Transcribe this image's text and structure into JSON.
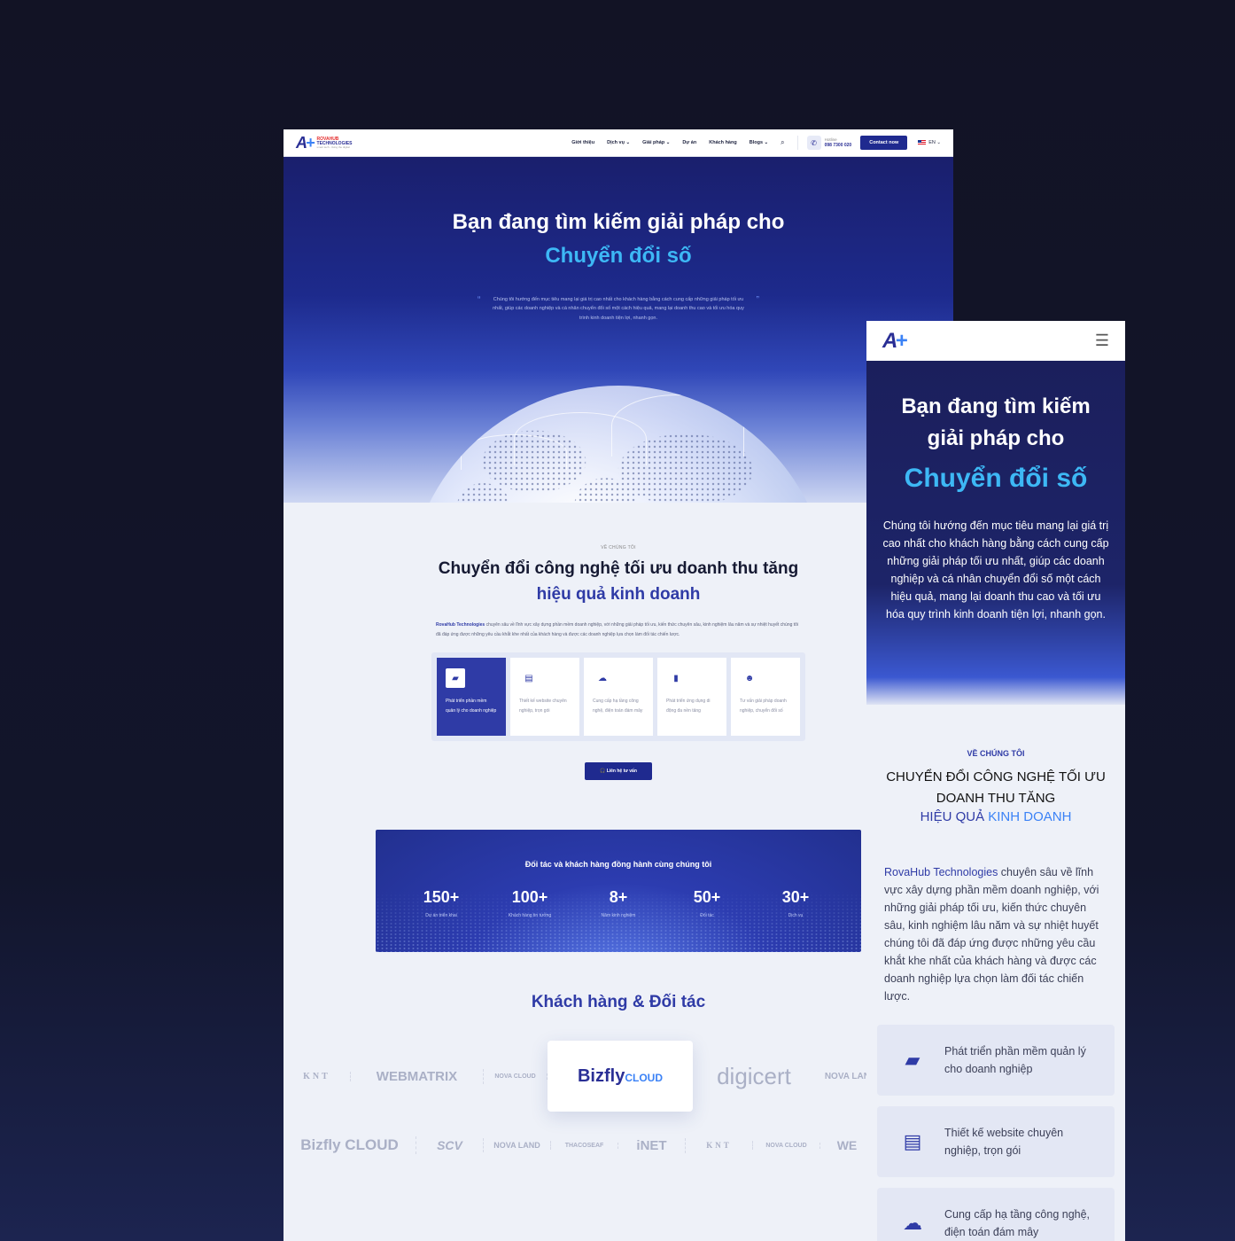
{
  "desktop": {
    "nav": {
      "logo_mark": "A+",
      "logo_line1": "ROVAHUB",
      "logo_line2": "TECHNOLOGIES",
      "logo_line3": "smart tech - living the digital",
      "menu": [
        "Giới thiệu",
        "Dịch vụ ⌄",
        "Giải pháp ⌄",
        "Dự án",
        "Khách hàng",
        "Blogs ⌄"
      ],
      "hotline_label": "Hotline",
      "hotline_number": "098 7300 020",
      "contact_button": "Contact now",
      "language": "EN ⌄"
    },
    "hero": {
      "title": "Bạn đang tìm kiếm giải pháp cho",
      "highlight": "Chuyển đổi số",
      "description": "Chúng tôi hướng đến mục tiêu mang lại giá trị cao nhất cho khách hàng bằng cách cung cấp những giải pháp tối ưu nhất, giúp các doanh nghiệp và cá nhân chuyển đổi số một cách hiệu quả, mang lại doanh thu cao và tối ưu hóa quy trình kinh doanh tiện lợi, nhanh gọn."
    },
    "about": {
      "eyebrow": "VỀ CHÚNG TÔI",
      "title": "Chuyển đổi công nghệ tối ưu doanh thu tăng",
      "highlight": "hiệu quả kinh doanh",
      "company": "RovaHub Technologies",
      "description": " chuyên sâu về lĩnh vực xây dựng phần mềm doanh nghiệp, với những giải pháp tối ưu, kiến thức chuyên sâu, kinh nghiệm lâu năm và sự nhiệt huyết chúng tôi đã đáp ứng được những yêu cầu khắt khe nhất của khách hàng và được các doanh nghiệp lựa chọn làm đối tác chiến lược.",
      "services": [
        {
          "icon": "laptop-icon",
          "label": "Phát triển phần mềm quản lý cho doanh nghiệp"
        },
        {
          "icon": "browser-icon",
          "label": "Thiết kế website chuyên nghiệp, trọn gói"
        },
        {
          "icon": "cloud-icon",
          "label": "Cung cấp hạ tầng công nghệ, điện toán đám mây"
        },
        {
          "icon": "mobile-icon",
          "label": "Phát triển ứng dụng di động đa nền tảng"
        },
        {
          "icon": "consultant-icon",
          "label": "Tư vấn giải pháp doanh nghiệp, chuyển đổi số"
        }
      ],
      "consult_button": "🎧 Liên hệ tư vấn"
    },
    "stats": {
      "heading": "Đối tác và khách hàng đồng hành cùng chúng tôi",
      "items": [
        {
          "value": "150+",
          "label": "Dự án triển khai"
        },
        {
          "value": "100+",
          "label": "Khách hàng tin tưởng"
        },
        {
          "value": "8+",
          "label": "Năm kinh nghiệm"
        },
        {
          "value": "50+",
          "label": "Đối tác"
        },
        {
          "value": "30+",
          "label": "Dịch vụ"
        }
      ]
    },
    "partners": {
      "title": "Khách hàng & Đối tác",
      "row1": [
        "KNT",
        "WEBMATRIX",
        "NOVA CLOUD",
        "Bizfly",
        "digicert",
        "NOVA LAND"
      ],
      "row1_highlight_suffix": "CLOUD",
      "row2": [
        "Bizfly CLOUD",
        "SCV",
        "NOVA LAND",
        "THACOSEAF",
        "iNET",
        "KNT",
        "NOVA CLOUD",
        "WE"
      ]
    }
  },
  "mobile": {
    "logo_mark": "A+",
    "menu_icon": "hamburger-icon",
    "hero": {
      "title": "Bạn đang tìm kiếm giải pháp cho",
      "highlight": "Chuyển đổi số",
      "description": "Chúng tôi hướng đến mục tiêu mang lại giá trị cao nhất cho khách hàng bằng cách cung cấp những giải pháp tối ưu nhất, giúp các doanh nghiệp và cá nhân chuyển đổi số một cách hiệu quả, mang lại doanh thu cao và tối ưu hóa quy trình kinh doanh tiện lợi, nhanh gọn."
    },
    "about": {
      "eyebrow": "VỀ CHÚNG TÔI",
      "title": "CHUYỂN ĐỔI CÔNG NGHỆ TỐI ƯU DOANH THU TĂNG",
      "highlight_a": "HIỆU QUẢ ",
      "highlight_b": "KINH DOANH",
      "company": "RovaHub Technologies",
      "description": " chuyên sâu về lĩnh vực xây dựng phần mềm doanh nghiệp, với những giải pháp tối ưu, kiến thức chuyên sâu, kinh nghiệm lâu năm và sự nhiệt huyết chúng tôi đã đáp ứng được những yêu cầu khắt khe nhất của khách hàng và được các doanh nghiệp lựa chọn làm đối tác chiến lược."
    },
    "cards": [
      {
        "icon": "laptop-icon",
        "label": "Phát triển phần mềm quản lý cho doanh nghiệp"
      },
      {
        "icon": "browser-icon",
        "label": "Thiết kế website chuyên nghiệp, trọn gói"
      },
      {
        "icon": "cloud-icon",
        "label": "Cung cấp hạ tầng công nghệ, điện toán đám mây"
      }
    ]
  }
}
